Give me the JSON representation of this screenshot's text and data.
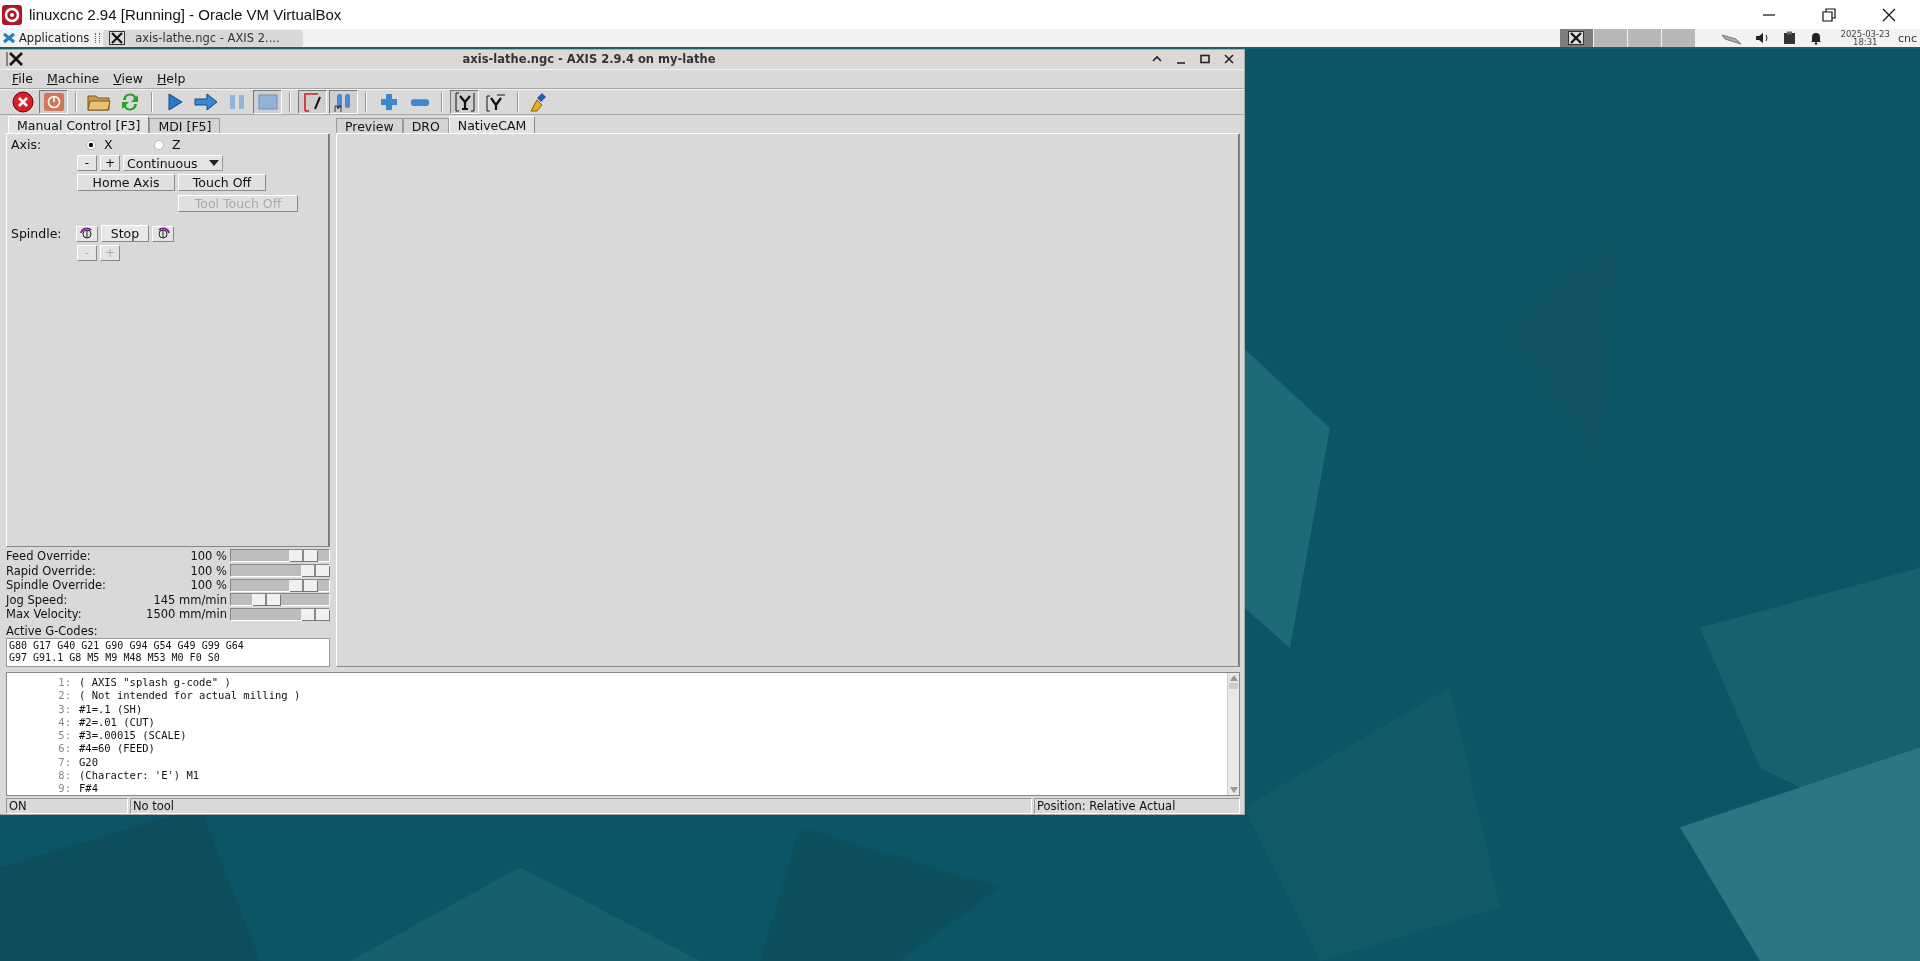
{
  "host_window": {
    "title": "linuxcnc 2.94 [Running] - Oracle VM VirtualBox"
  },
  "taskbar": {
    "menu_label": "Applications",
    "tasks": [
      {
        "label": "axis-lathe.ngc - AXIS 2....",
        "selected": true
      }
    ],
    "pager": [
      {
        "selected": true
      },
      {
        "selected": false
      },
      {
        "selected": false
      },
      {
        "selected": false
      }
    ],
    "date": "2025-03-23",
    "time": "18:31",
    "user": "cnc"
  },
  "axis_window": {
    "title": "axis-lathe.ngc - AXIS 2.9.4 on my-lathe",
    "menu": [
      "File",
      "Machine",
      "View",
      "Help"
    ],
    "toolbar": [
      {
        "kind": "estop",
        "pressed": false
      },
      {
        "kind": "power",
        "pressed": true
      },
      {
        "kind": "sep"
      },
      {
        "kind": "open",
        "pressed": false
      },
      {
        "kind": "reload",
        "pressed": false
      },
      {
        "kind": "sep"
      },
      {
        "kind": "run",
        "pressed": false
      },
      {
        "kind": "step",
        "pressed": false
      },
      {
        "kind": "pause",
        "pressed": false
      },
      {
        "kind": "stop",
        "pressed": true
      },
      {
        "kind": "sep"
      },
      {
        "kind": "block-delete",
        "pressed": true
      },
      {
        "kind": "optional-stop",
        "pressed": true
      },
      {
        "kind": "sep"
      },
      {
        "kind": "zoom-in",
        "pressed": false
      },
      {
        "kind": "zoom-out",
        "pressed": false
      },
      {
        "kind": "sep"
      },
      {
        "kind": "view-top",
        "pressed": true
      },
      {
        "kind": "view-rotated",
        "pressed": false
      },
      {
        "kind": "sep"
      },
      {
        "kind": "clear",
        "pressed": false
      }
    ],
    "left_tabs": [
      {
        "label": "Manual Control [F3]",
        "selected": true
      },
      {
        "label": "MDI [F5]",
        "selected": false
      }
    ],
    "manual": {
      "axis_label": "Axis:",
      "axes": [
        {
          "label": "X",
          "selected": true
        },
        {
          "label": "Z",
          "selected": false
        }
      ],
      "jog_minus": "-",
      "jog_plus": "+",
      "increment": "Continuous",
      "buttons": [
        {
          "label": "Home Axis",
          "disabled": false
        },
        {
          "label": "Touch Off",
          "disabled": false
        },
        {
          "label": "Tool Touch Off",
          "disabled": true
        }
      ],
      "spindle_label": "Spindle:",
      "spindle_stop": "Stop",
      "spindle_minus": "-",
      "spindle_plus": "+",
      "spindle_adjust_disabled": true
    },
    "overrides": [
      {
        "label": "Feed Override:",
        "value": "100 %",
        "level": 0.83
      },
      {
        "label": "Rapid Override:",
        "value": "100 %",
        "level": 1.0
      },
      {
        "label": "Spindle Override:",
        "value": "100 %",
        "level": 0.83
      },
      {
        "label": "Jog Speed:",
        "value": "145 mm/min",
        "level": 0.3
      },
      {
        "label": "Max Velocity:",
        "value": "1500 mm/min",
        "level": 1.0
      }
    ],
    "active_gcodes": {
      "label": "Active G-Codes:",
      "lines": [
        "G80 G17 G40 G21 G90 G94 G54 G49 G99 G64",
        "G97 G91.1 G8 M5 M9 M48 M53 M0 F0 S0"
      ]
    },
    "right_tabs": [
      {
        "label": "Preview",
        "selected": false
      },
      {
        "label": "DRO",
        "selected": false
      },
      {
        "label": "NativeCAM",
        "selected": true
      }
    ],
    "code": [
      {
        "number": "1:",
        "text": "( AXIS \"splash g-code\" )"
      },
      {
        "number": "2:",
        "text": "( Not intended for actual milling )"
      },
      {
        "number": "3:",
        "text": "#1=.1 (SH)"
      },
      {
        "number": "4:",
        "text": "#2=.01 (CUT)"
      },
      {
        "number": "5:",
        "text": "#3=.00015 (SCALE)"
      },
      {
        "number": "6:",
        "text": "#4=60 (FEED)"
      },
      {
        "number": "7:",
        "text": "G20"
      },
      {
        "number": "8:",
        "text": "(Character: 'E') M1"
      },
      {
        "number": "9:",
        "text": "F#4"
      }
    ],
    "status_bar": {
      "state": "ON",
      "tool": "No tool",
      "position": "Position: Relative Actual"
    }
  }
}
